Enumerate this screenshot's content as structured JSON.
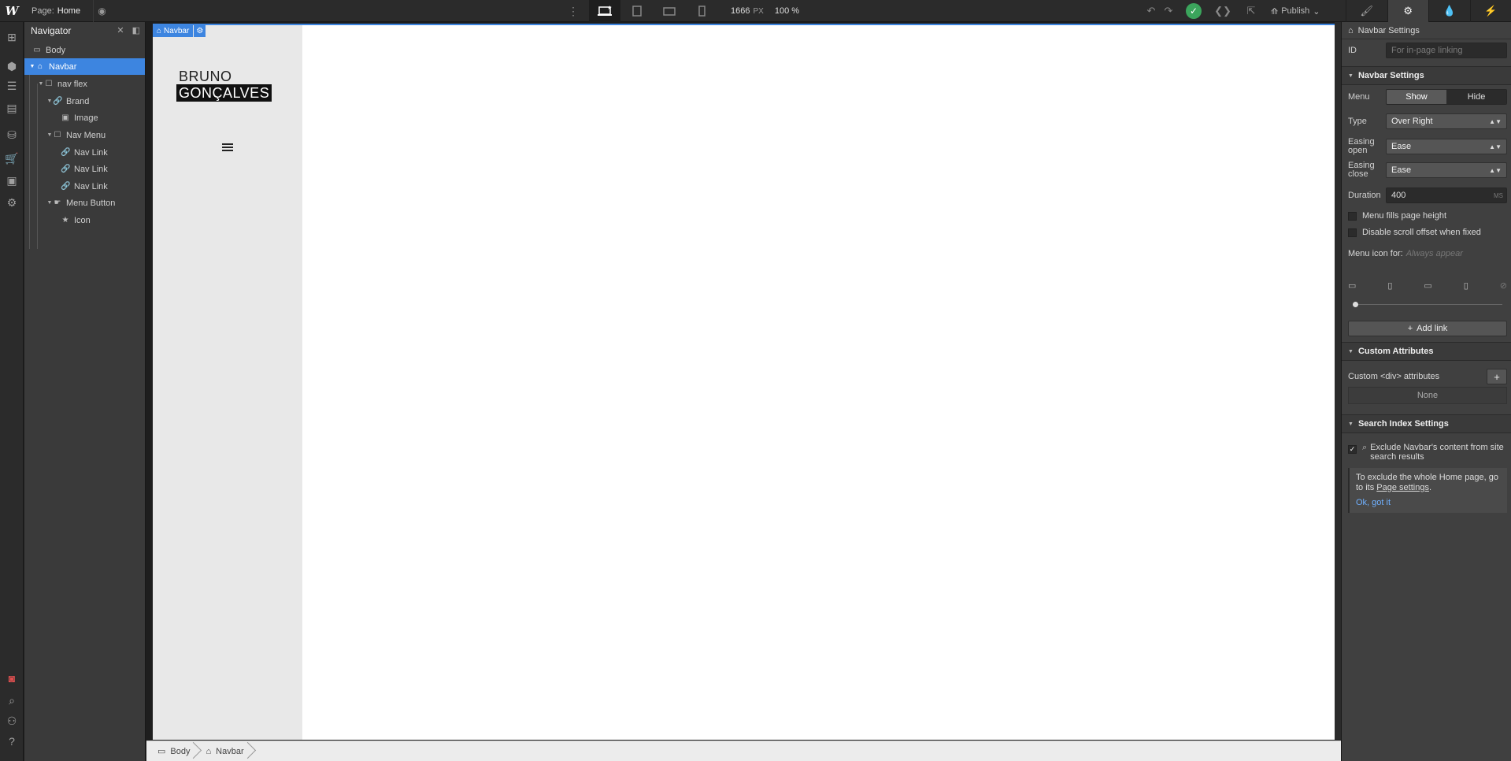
{
  "topbar": {
    "logo": "W",
    "page_label": "Page:",
    "page_name": "Home",
    "canvas_width": "1666",
    "width_unit": "PX",
    "zoom": "100 %",
    "publish_label": "Publish"
  },
  "navigator": {
    "title": "Navigator",
    "items": [
      {
        "label": "Body",
        "icon": "square-icon"
      },
      {
        "label": "Navbar",
        "icon": "home-icon"
      },
      {
        "label": "nav flex",
        "icon": "box-icon"
      },
      {
        "label": "Brand",
        "icon": "link-icon"
      },
      {
        "label": "Image",
        "icon": "image-icon"
      },
      {
        "label": "Nav Menu",
        "icon": "box-icon"
      },
      {
        "label": "Nav Link",
        "icon": "link-icon"
      },
      {
        "label": "Nav Link",
        "icon": "link-icon"
      },
      {
        "label": "Nav Link",
        "icon": "link-icon"
      },
      {
        "label": "Menu Button",
        "icon": "hand-icon"
      },
      {
        "label": "Icon",
        "icon": "star-icon"
      }
    ]
  },
  "canvas": {
    "selected_tag": "Navbar",
    "brand_line1": "BRUNO",
    "brand_line2": "GONÇALVES"
  },
  "breadcrumbs": [
    "Body",
    "Navbar"
  ],
  "panel": {
    "header": "Navbar Settings",
    "id_label": "ID",
    "id_placeholder": "For in-page linking",
    "section_navbar": "Navbar Settings",
    "menu_label": "Menu",
    "menu_show": "Show",
    "menu_hide": "Hide",
    "type_label": "Type",
    "type_value": "Over Right",
    "easing_open_label": "Easing open",
    "easing_open_value": "Ease",
    "easing_close_label": "Easing close",
    "easing_close_value": "Ease",
    "duration_label": "Duration",
    "duration_value": "400",
    "duration_unit": "MS",
    "fills_label": "Menu fills page height",
    "scroll_label": "Disable scroll offset when fixed",
    "menu_icon_label": "Menu icon for:",
    "menu_icon_value": "Always appear",
    "add_link": "Add link",
    "section_custom": "Custom Attributes",
    "custom_label": "Custom <div> attributes",
    "none": "None",
    "section_search": "Search Index Settings",
    "exclude_label": "Exclude Navbar's content from site search results",
    "notice_text": "To exclude the whole Home page, go to its",
    "notice_link": "Page settings",
    "notice_end": ".",
    "notice_ok": "Ok, got it"
  },
  "colors": {
    "accent": "#3d85e0",
    "success": "#3ba55c"
  }
}
